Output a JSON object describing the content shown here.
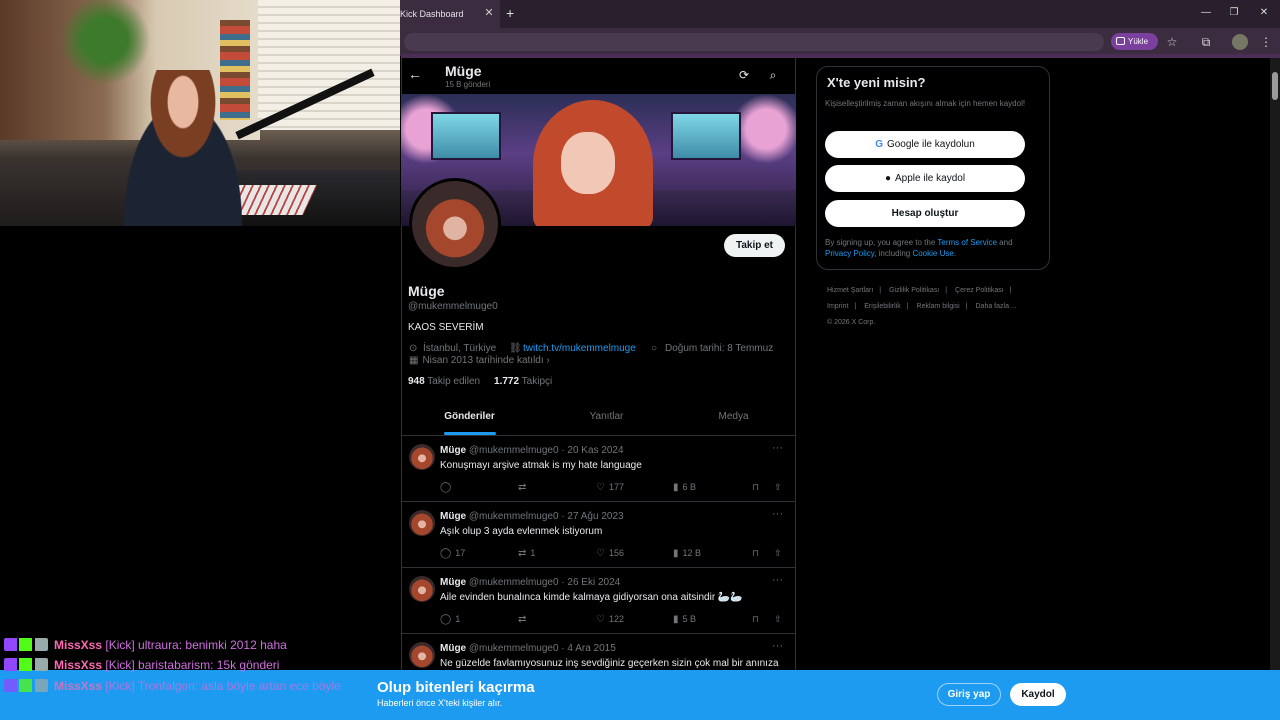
{
  "browser": {
    "tab_title": "Kick Dashboard",
    "tab_close": "✕",
    "new_tab": "+",
    "window_controls": [
      "—",
      "❐",
      "✕"
    ],
    "upload_label": "Yükle"
  },
  "profile_header": {
    "name": "Müge",
    "post_count": "15 B gönderi"
  },
  "profile": {
    "follow_label": "Takip et",
    "name": "Müge",
    "handle": "@mukemmelmuge0",
    "bio": "KAOS SEVERİM",
    "location": "İstanbul, Türkiye",
    "link": "twitch.tv/mukemmelmuge",
    "birthday": "Doğum tarihi: 8 Temmuz",
    "joined": "Nisan 2013 tarihinde katıldı",
    "following_count": "948",
    "following_label": "Takip edilen",
    "followers_count": "1.772",
    "followers_label": "Takipçi"
  },
  "tabs": [
    "Gönderiler",
    "Yanıtlar",
    "Medya"
  ],
  "tweets": [
    {
      "name": "Müge",
      "meta": "@mukemmelmuge0 · 20 Kas 2024",
      "text": "Konuşmayı arşive atmak is my hate language",
      "replies": "",
      "retweets": "",
      "likes": "177",
      "views": "6 B"
    },
    {
      "name": "Müge",
      "meta": "@mukemmelmuge0 · 27 Ağu 2023",
      "text": "Aşık olup 3 ayda evlenmek istiyorum",
      "replies": "17",
      "retweets": "1",
      "likes": "156",
      "views": "12 B"
    },
    {
      "name": "Müge",
      "meta": "@mukemmelmuge0 · 26 Eki 2024",
      "text": "Aile evinden bunalınca kimde kalmaya gidiyorsan ona aitsindir 🦢🦢",
      "replies": "1",
      "retweets": "",
      "likes": "122",
      "views": "5 B"
    },
    {
      "name": "Müge",
      "meta": "@mukemmelmuge0 · 4 Ara 2015",
      "text": "Ne güzelde favlamıyosunuz inş sevdiğiniz geçerken sizin çok mal bir anınıza",
      "replies": "",
      "retweets": "",
      "likes": "",
      "views": ""
    }
  ],
  "sidebar": {
    "title": "X'te yeni misin?",
    "subtitle": "Kişiselleştirilmiş zaman akışını almak için hemen kaydol!",
    "google_label": "Google ile kaydolun",
    "apple_label": "Apple ile kaydol",
    "create_label": "Hesap oluştur",
    "terms_prefix": "By signing up, you agree to the ",
    "terms_link": "Terms of Service",
    "terms_mid": " and ",
    "privacy_link": "Privacy Policy",
    "terms_mid2": ", including ",
    "cookie_link": "Cookie Use",
    "terms_end": ".",
    "footer_links": [
      "Hizmet Şartları",
      "|",
      "Gizlilik Politikası",
      "|",
      "Çerez Politikası",
      "|",
      "Imprint",
      "|",
      "Erişilebilirlik",
      "|",
      "Reklam bilgisi",
      "|",
      "Daha fazla ...",
      "© 2026 X Corp."
    ]
  },
  "bottom_bar": {
    "title": "Olup bitenleri kaçırma",
    "subtitle": "Haberleri önce X'teki kişiler alır.",
    "login_label": "Giriş yap",
    "register_label": "Kaydol"
  },
  "chat": [
    {
      "user": "MissXss",
      "message": "[Kick] ultraura: benimki 2012 haha"
    },
    {
      "user": "MissXss",
      "message": "[Kick] baristabarism: 15k gönderi"
    },
    {
      "user": "MissXss",
      "message": "[Kick] Tronfalgon: asla böyle artan ece böyle"
    }
  ],
  "colors": {
    "accent": "#1d9bf0",
    "background": "#000000",
    "chat_user": "#ff69b4"
  }
}
